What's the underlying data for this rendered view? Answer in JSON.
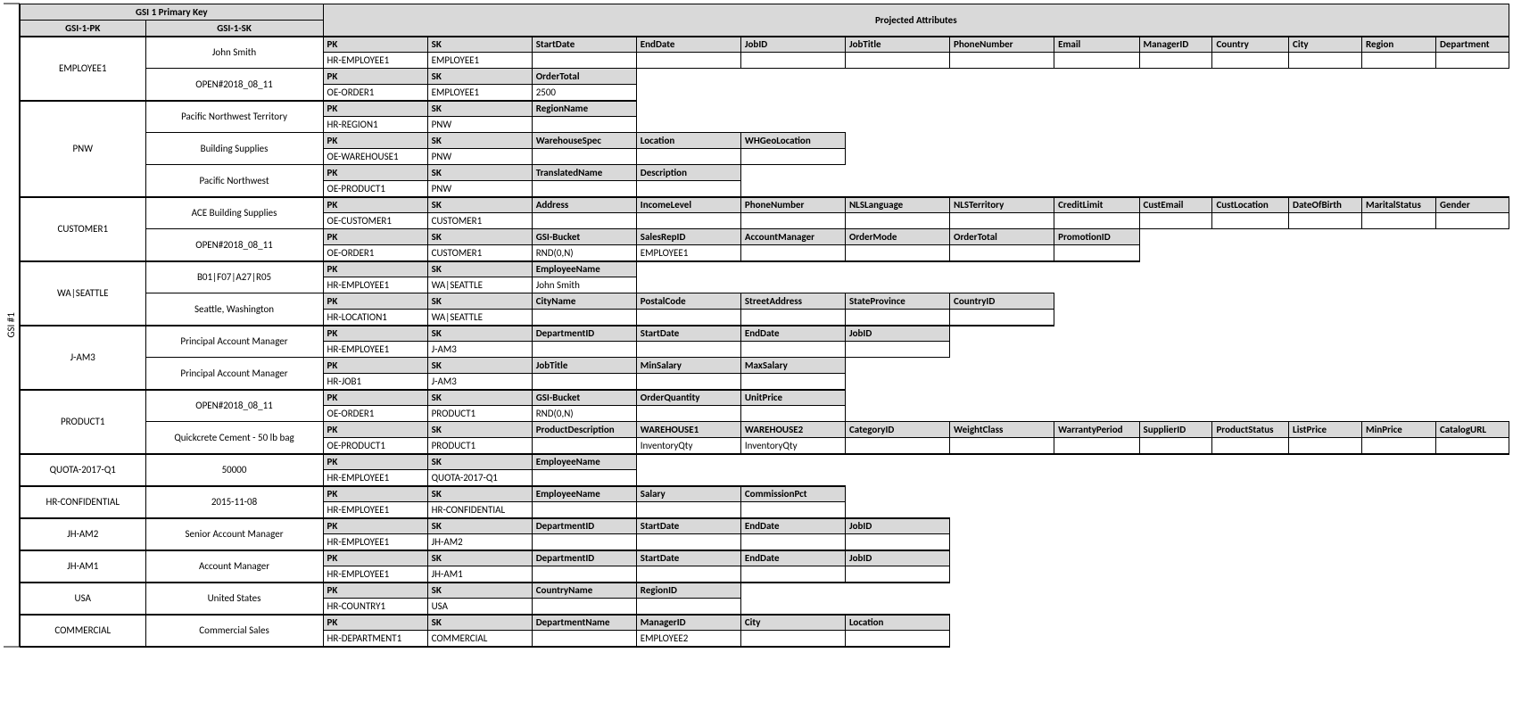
{
  "sidebar_label": "GSI #1",
  "top": {
    "primary_key_title": "GSI 1 Primary Key",
    "projected_title": "Projected Attributes",
    "gsi_pk": "GSI-1-PK",
    "gsi_sk": "GSI-1-SK"
  },
  "groups": [
    {
      "pk": "EMPLOYEE1",
      "rows": [
        {
          "sk": "John Smith",
          "headers": [
            "PK",
            "SK",
            "StartDate",
            "EndDate",
            "JobID",
            "JobTitle",
            "PhoneNumber",
            "Email",
            "ManagerID",
            "Country",
            "City",
            "Region",
            "Department"
          ],
          "values": [
            "HR-EMPLOYEE1",
            "EMPLOYEE1",
            "",
            "",
            "",
            "",
            "",
            "",
            "",
            "",
            "",
            "",
            ""
          ]
        },
        {
          "sk": "OPEN#2018_08_11",
          "headers": [
            "PK",
            "SK",
            "OrderTotal"
          ],
          "values": [
            "OE-ORDER1",
            "EMPLOYEE1",
            "2500"
          ]
        }
      ]
    },
    {
      "pk": "PNW",
      "rows": [
        {
          "sk": "Pacific Northwest Territory",
          "headers": [
            "PK",
            "SK",
            "RegionName"
          ],
          "values": [
            "HR-REGION1",
            "PNW",
            ""
          ]
        },
        {
          "sk": "Building Supplies",
          "headers": [
            "PK",
            "SK",
            "WarehouseSpec",
            "Location",
            "WHGeoLocation"
          ],
          "values": [
            "OE-WAREHOUSE1",
            "PNW",
            "",
            "",
            ""
          ]
        },
        {
          "sk": "Pacific Northwest",
          "headers": [
            "PK",
            "SK",
            "TranslatedName",
            "Description"
          ],
          "values": [
            "OE-PRODUCT1",
            "PNW",
            "",
            ""
          ]
        }
      ]
    },
    {
      "pk": "CUSTOMER1",
      "rows": [
        {
          "sk": "ACE Building Supplies",
          "headers": [
            "PK",
            "SK",
            "Address",
            "IncomeLevel",
            "PhoneNumber",
            "NLSLanguage",
            "NLSTerritory",
            "CreditLimit",
            "CustEmail",
            "CustLocation",
            "DateOfBirth",
            "MaritalStatus",
            "Gender"
          ],
          "values": [
            "OE-CUSTOMER1",
            "CUSTOMER1",
            "",
            "",
            "",
            "",
            "",
            "",
            "",
            "",
            "",
            "",
            ""
          ]
        },
        {
          "sk": "OPEN#2018_08_11",
          "headers": [
            "PK",
            "SK",
            "GSI-Bucket",
            "SalesRepID",
            "AccountManager",
            "OrderMode",
            "OrderTotal",
            "PromotionID"
          ],
          "values": [
            "OE-ORDER1",
            "CUSTOMER1",
            "RND(0,N)",
            "EMPLOYEE1",
            "",
            "",
            "",
            ""
          ]
        }
      ]
    },
    {
      "pk": "WA|SEATTLE",
      "rows": [
        {
          "sk": "B01|F07|A27|R05",
          "headers": [
            "PK",
            "SK",
            "EmployeeName"
          ],
          "values": [
            "HR-EMPLOYEE1",
            "WA|SEATTLE",
            "John Smith"
          ]
        },
        {
          "sk": "Seattle, Washington",
          "headers": [
            "PK",
            "SK",
            "CityName",
            "PostalCode",
            "StreetAddress",
            "StateProvince",
            "CountryID"
          ],
          "values": [
            "HR-LOCATION1",
            "WA|SEATTLE",
            "",
            "",
            "",
            "",
            ""
          ]
        }
      ]
    },
    {
      "pk": "J-AM3",
      "rows": [
        {
          "sk": "Principal Account Manager",
          "headers": [
            "PK",
            "SK",
            "DepartmentID",
            "StartDate",
            "EndDate",
            "JobID"
          ],
          "values": [
            "HR-EMPLOYEE1",
            "J-AM3",
            "",
            "",
            "",
            ""
          ]
        },
        {
          "sk": "Principal Account Manager",
          "headers": [
            "PK",
            "SK",
            "JobTitle",
            "MinSalary",
            "MaxSalary"
          ],
          "values": [
            "HR-JOB1",
            "J-AM3",
            "",
            "",
            ""
          ]
        }
      ]
    },
    {
      "pk": "PRODUCT1",
      "rows": [
        {
          "sk": "OPEN#2018_08_11",
          "headers": [
            "PK",
            "SK",
            "GSI-Bucket",
            "OrderQuantity",
            "UnitPrice"
          ],
          "values": [
            "OE-ORDER1",
            "PRODUCT1",
            "RND(0,N)",
            "",
            ""
          ]
        },
        {
          "sk": "Quickcrete Cement - 50 lb bag",
          "headers": [
            "PK",
            "SK",
            "ProductDescription",
            "WAREHOUSE1",
            "WAREHOUSE2",
            "CategoryID",
            "WeightClass",
            "WarrantyPeriod",
            "SupplierID",
            "ProductStatus",
            "ListPrice",
            "MinPrice",
            "CatalogURL"
          ],
          "values": [
            "OE-PRODUCT1",
            "PRODUCT1",
            "",
            "InventoryQty",
            "InventoryQty",
            "",
            "",
            "",
            "",
            "",
            "",
            "",
            ""
          ]
        }
      ]
    },
    {
      "pk": "QUOTA-2017-Q1",
      "rows": [
        {
          "sk": "50000",
          "headers": [
            "PK",
            "SK",
            "EmployeeName"
          ],
          "values": [
            "HR-EMPLOYEE1",
            "QUOTA-2017-Q1",
            ""
          ]
        }
      ]
    },
    {
      "pk": "HR-CONFIDENTIAL",
      "rows": [
        {
          "sk": "2015-11-08",
          "headers": [
            "PK",
            "SK",
            "EmployeeName",
            "Salary",
            "CommissionPct"
          ],
          "values": [
            "HR-EMPLOYEE1",
            "HR-CONFIDENTIAL",
            "",
            "",
            ""
          ]
        }
      ]
    },
    {
      "pk": "JH-AM2",
      "rows": [
        {
          "sk": "Senior Account Manager",
          "headers": [
            "PK",
            "SK",
            "DepartmentID",
            "StartDate",
            "EndDate",
            "JobID"
          ],
          "values": [
            "HR-EMPLOYEE1",
            "JH-AM2",
            "",
            "",
            "",
            ""
          ]
        }
      ]
    },
    {
      "pk": "JH-AM1",
      "rows": [
        {
          "sk": "Account Manager",
          "headers": [
            "PK",
            "SK",
            "DepartmentID",
            "StartDate",
            "EndDate",
            "JobID"
          ],
          "values": [
            "HR-EMPLOYEE1",
            "JH-AM1",
            "",
            "",
            "",
            ""
          ]
        }
      ]
    },
    {
      "pk": "USA",
      "rows": [
        {
          "sk": "United States",
          "headers": [
            "PK",
            "SK",
            "CountryName",
            "RegionID"
          ],
          "values": [
            "HR-COUNTRY1",
            "USA",
            "",
            ""
          ]
        }
      ]
    },
    {
      "pk": "COMMERCIAL",
      "rows": [
        {
          "sk": "Commercial Sales",
          "headers": [
            "PK",
            "SK",
            "DepartmentName",
            "ManagerID",
            "City",
            "Location"
          ],
          "values": [
            "HR-DEPARTMENT1",
            "COMMERCIAL",
            "",
            "EMPLOYEE2",
            "",
            ""
          ]
        }
      ]
    }
  ]
}
